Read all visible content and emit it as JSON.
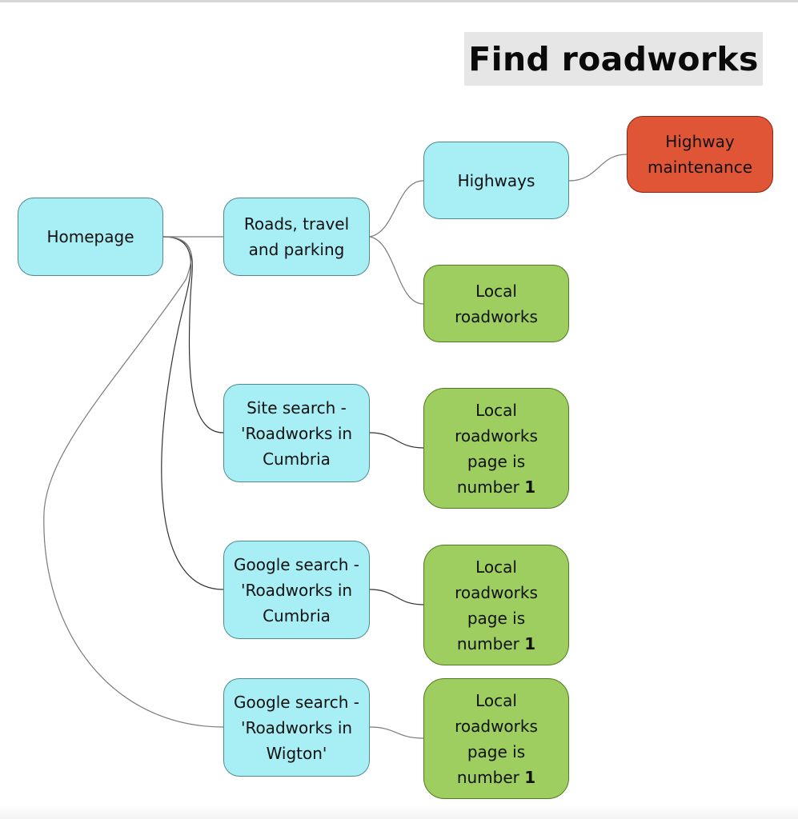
{
  "title": "Find roadworks",
  "colors": {
    "page_node": "#a7eef5",
    "success_node": "#9dce5f",
    "failure_node": "#e05535",
    "title_background": "#e6e6e6"
  },
  "nodes": {
    "homepage": {
      "label": "Homepage",
      "type": "page"
    },
    "roads": {
      "label": "Roads, travel and parking",
      "type": "page"
    },
    "highways": {
      "label": "Highways",
      "type": "page"
    },
    "highway_maintenance": {
      "label": "Highway maintenance",
      "type": "failure"
    },
    "local_roadworks": {
      "label": "Local roadworks",
      "type": "success"
    },
    "site_search": {
      "label": "Site search - 'Roadworks in Cumbria",
      "type": "page"
    },
    "site_search_result": {
      "label": "Local roadworks page is number",
      "rank": "1",
      "type": "success"
    },
    "google_cumbria": {
      "label": "Google search - 'Roadworks in Cumbria",
      "type": "page"
    },
    "google_cumbria_result": {
      "label": "Local roadworks page is number",
      "rank": "1",
      "type": "success"
    },
    "google_wigton": {
      "label": "Google search - 'Roadworks in Wigton'",
      "type": "page"
    },
    "google_wigton_result": {
      "label": "Local roadworks page is number",
      "rank": "1",
      "type": "success"
    }
  },
  "edges": [
    [
      "homepage",
      "roads"
    ],
    [
      "roads",
      "highways"
    ],
    [
      "highways",
      "highway_maintenance"
    ],
    [
      "roads",
      "local_roadworks"
    ],
    [
      "homepage",
      "site_search"
    ],
    [
      "site_search",
      "site_search_result"
    ],
    [
      "homepage",
      "google_cumbria"
    ],
    [
      "google_cumbria",
      "google_cumbria_result"
    ],
    [
      "homepage",
      "google_wigton"
    ],
    [
      "google_wigton",
      "google_wigton_result"
    ]
  ]
}
